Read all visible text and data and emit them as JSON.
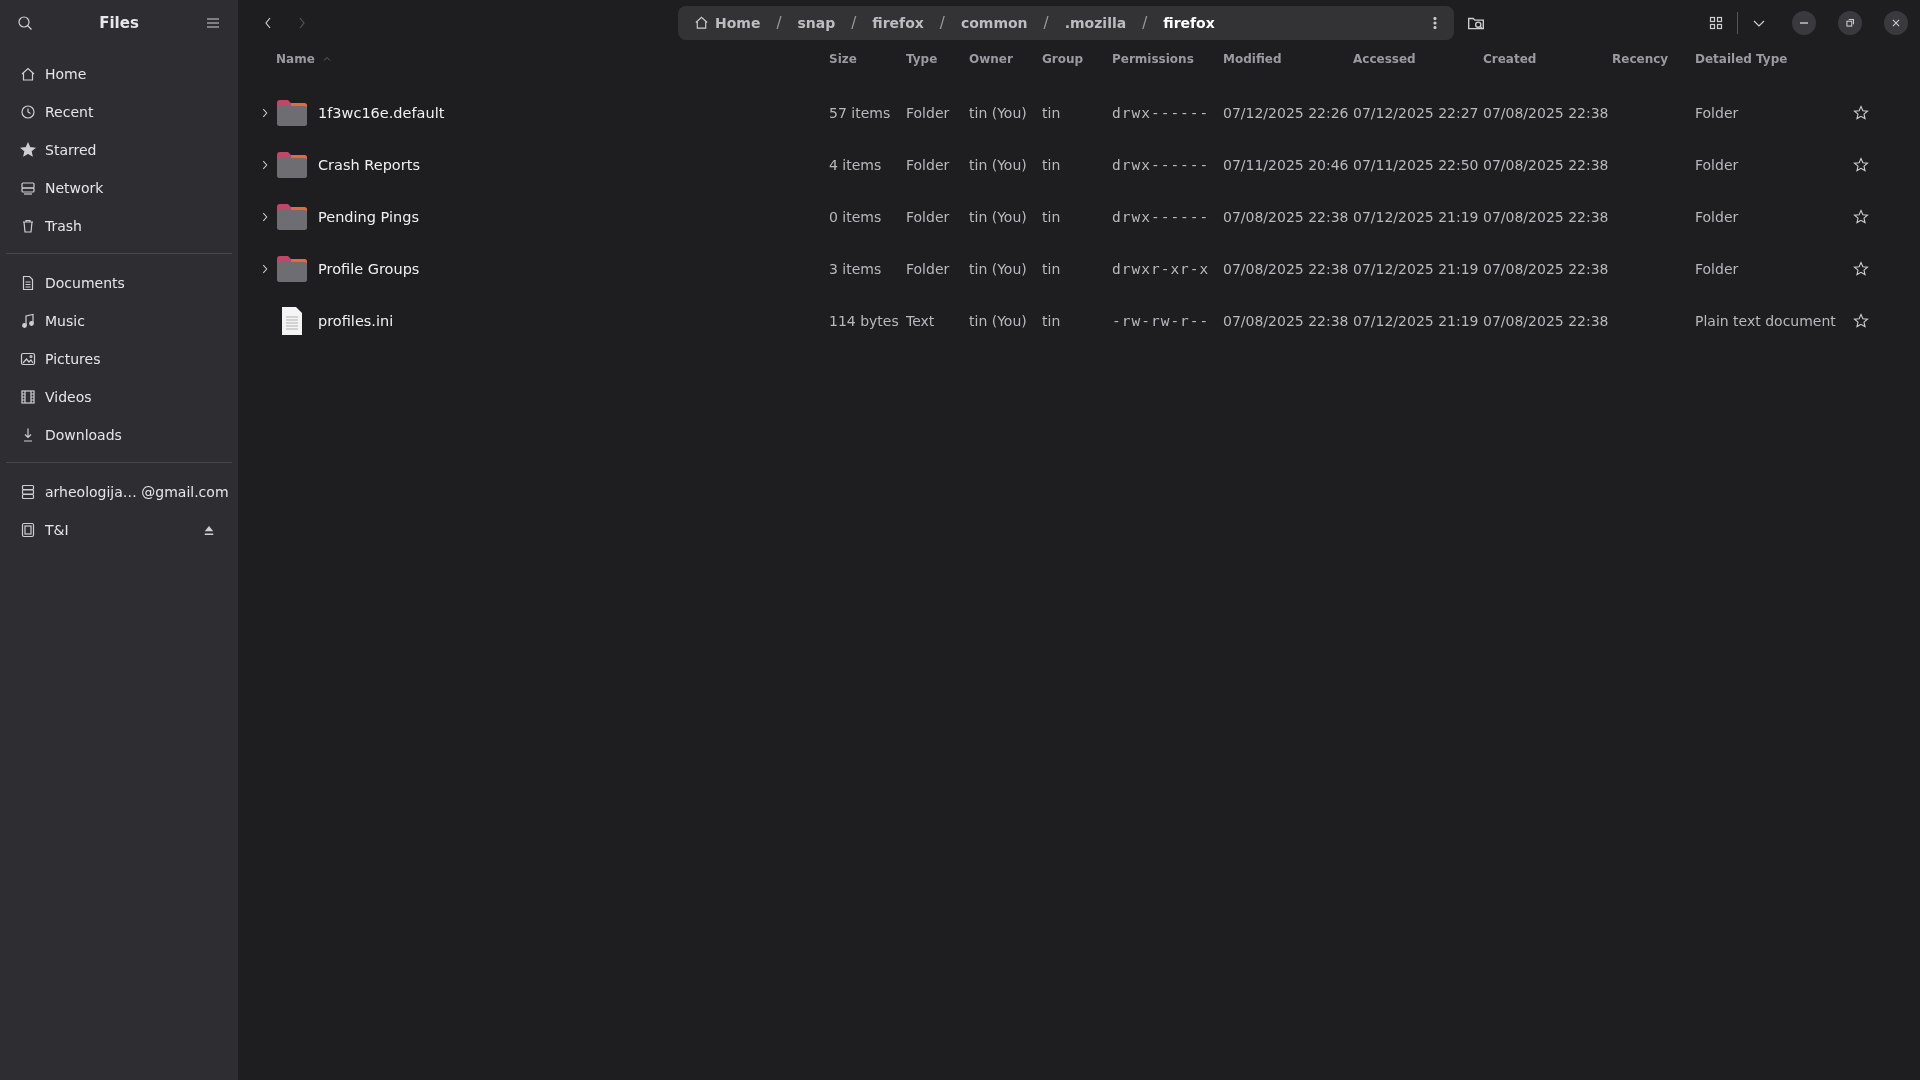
{
  "sidebar": {
    "title": "Files",
    "sections": [
      [
        {
          "label": "Home",
          "kind": "home"
        },
        {
          "label": "Recent",
          "kind": "recent"
        },
        {
          "label": "Starred",
          "kind": "starred"
        },
        {
          "label": "Network",
          "kind": "network"
        },
        {
          "label": "Trash",
          "kind": "trash"
        }
      ],
      [
        {
          "label": "Documents",
          "kind": "documents"
        },
        {
          "label": "Music",
          "kind": "music"
        },
        {
          "label": "Pictures",
          "kind": "pictures"
        },
        {
          "label": "Videos",
          "kind": "videos"
        },
        {
          "label": "Downloads",
          "kind": "downloads"
        }
      ],
      [
        {
          "label": "arheologija… @gmail.com",
          "kind": "account"
        },
        {
          "label": "T&I",
          "kind": "device",
          "eject": true
        }
      ]
    ]
  },
  "breadcrumb": [
    {
      "label": "Home",
      "selected": false
    },
    {
      "separator": "/",
      "label": "snap",
      "selected": false
    },
    {
      "separator": "/",
      "label": "firefox",
      "selected": false
    },
    {
      "separator": "/",
      "label": "common",
      "selected": false
    },
    {
      "separator": "/",
      "label": ".mozilla",
      "selected": false
    },
    {
      "separator": "/",
      "label": "firefox",
      "selected": true
    }
  ],
  "table": {
    "columns": [
      "Name",
      "Size",
      "Type",
      "Owner",
      "Group",
      "Permissions",
      "Modified",
      "Accessed",
      "Created",
      "Recency",
      "Detailed Type"
    ],
    "rows": [
      {
        "kind": "folder",
        "name": "1f3wc16e.default",
        "size": "57 items",
        "type": "Folder",
        "owner": "tin (You)",
        "group": "tin",
        "permissions": "drwx------",
        "modified": "07/12/2025 22:26",
        "accessed": "07/12/2025 22:27",
        "created": "07/08/2025 22:38",
        "detailed_type": "Folder",
        "starred": false
      },
      {
        "kind": "folder",
        "name": "Crash Reports",
        "size": "4 items",
        "type": "Folder",
        "owner": "tin (You)",
        "group": "tin",
        "permissions": "drwx------",
        "modified": "07/11/2025 20:46",
        "accessed": "07/11/2025 22:50",
        "created": "07/08/2025 22:38",
        "detailed_type": "Folder",
        "starred": false
      },
      {
        "kind": "folder",
        "name": "Pending Pings",
        "size": "0 items",
        "type": "Folder",
        "owner": "tin (You)",
        "group": "tin",
        "permissions": "drwx------",
        "modified": "07/08/2025 22:38",
        "accessed": "07/12/2025 21:19",
        "created": "07/08/2025 22:38",
        "detailed_type": "Folder",
        "starred": false
      },
      {
        "kind": "folder",
        "name": "Profile Groups",
        "size": "3 items",
        "type": "Folder",
        "owner": "tin (You)",
        "group": "tin",
        "permissions": "drwxr-xr-x",
        "modified": "07/08/2025 22:38",
        "accessed": "07/12/2025 21:19",
        "created": "07/08/2025 22:38",
        "detailed_type": "Folder",
        "starred": false
      },
      {
        "kind": "file",
        "name": "profiles.ini",
        "size": "114 bytes",
        "type": "Text",
        "owner": "tin (You)",
        "group": "tin",
        "permissions": "-rw-rw-r--",
        "modified": "07/08/2025 22:38",
        "accessed": "07/12/2025 21:19",
        "created": "07/08/2025 22:38",
        "detailed_type": "Plain text document",
        "starred": false
      }
    ]
  }
}
